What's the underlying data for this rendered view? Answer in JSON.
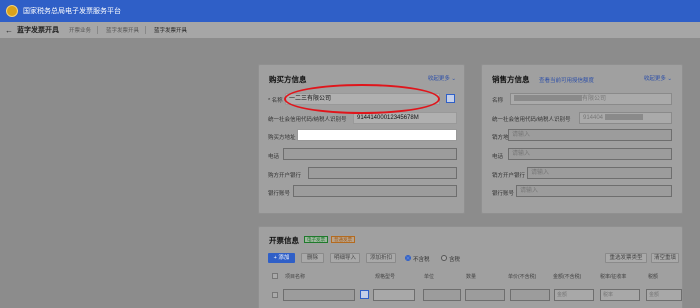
{
  "header": {
    "title": "国家税务总局电子发票服务平台"
  },
  "subheader": {
    "back_icon": "back-arrow-icon",
    "page_title": "蓝字发票开具",
    "breadcrumbs": [
      "开票业务",
      "蓝字发票开具",
      "蓝字发票开具"
    ]
  },
  "buyer": {
    "title": "购买方信息",
    "collapse": "收起更多 ⌄",
    "name_label": "* 名称",
    "name_value": "一二三有限公司",
    "taxid_label": "统一社会信用代码/纳税人识别号",
    "taxid_value": "91441400012345678M",
    "address_label": "购买方地址",
    "address_value": "",
    "phone_label": "电话",
    "bank_label": "购方开户银行",
    "account_label": "银行账号"
  },
  "seller": {
    "title": "销售方信息",
    "link": "查看当前可用授信额度",
    "collapse": "收起更多 ⌄",
    "name_label": "名称",
    "name_value": "有限公司",
    "taxid_label": "统一社会信用代码/纳税人识别号",
    "taxid_value": "914404",
    "address_label": "销方地址",
    "address_placeholder": "请输入",
    "phone_label": "电话",
    "phone_placeholder": "请输入",
    "bank_label": "销方开户银行",
    "bank_placeholder": "请输入",
    "account_label": "银行账号",
    "account_placeholder": "请输入"
  },
  "invoice": {
    "title": "开票信息",
    "tag_green": "电子发票",
    "tag_orange": "普通发票",
    "toolbar": {
      "add": "+ 添加",
      "delete": "删除",
      "import": "明细导入",
      "discount": "添加折扣",
      "tax_excluded": "不含税",
      "tax_included": "含税",
      "reselect": "重选发票类型",
      "clear": "清空重填"
    },
    "columns": [
      "项目名称",
      "规格型号",
      "单位",
      "数量",
      "单价(不含税)",
      "金额(不含税)",
      "税率/征收率",
      "税额"
    ],
    "row": {
      "amount_placeholder": "金额",
      "rate_value": "税率",
      "tax_placeholder": "金额"
    }
  }
}
